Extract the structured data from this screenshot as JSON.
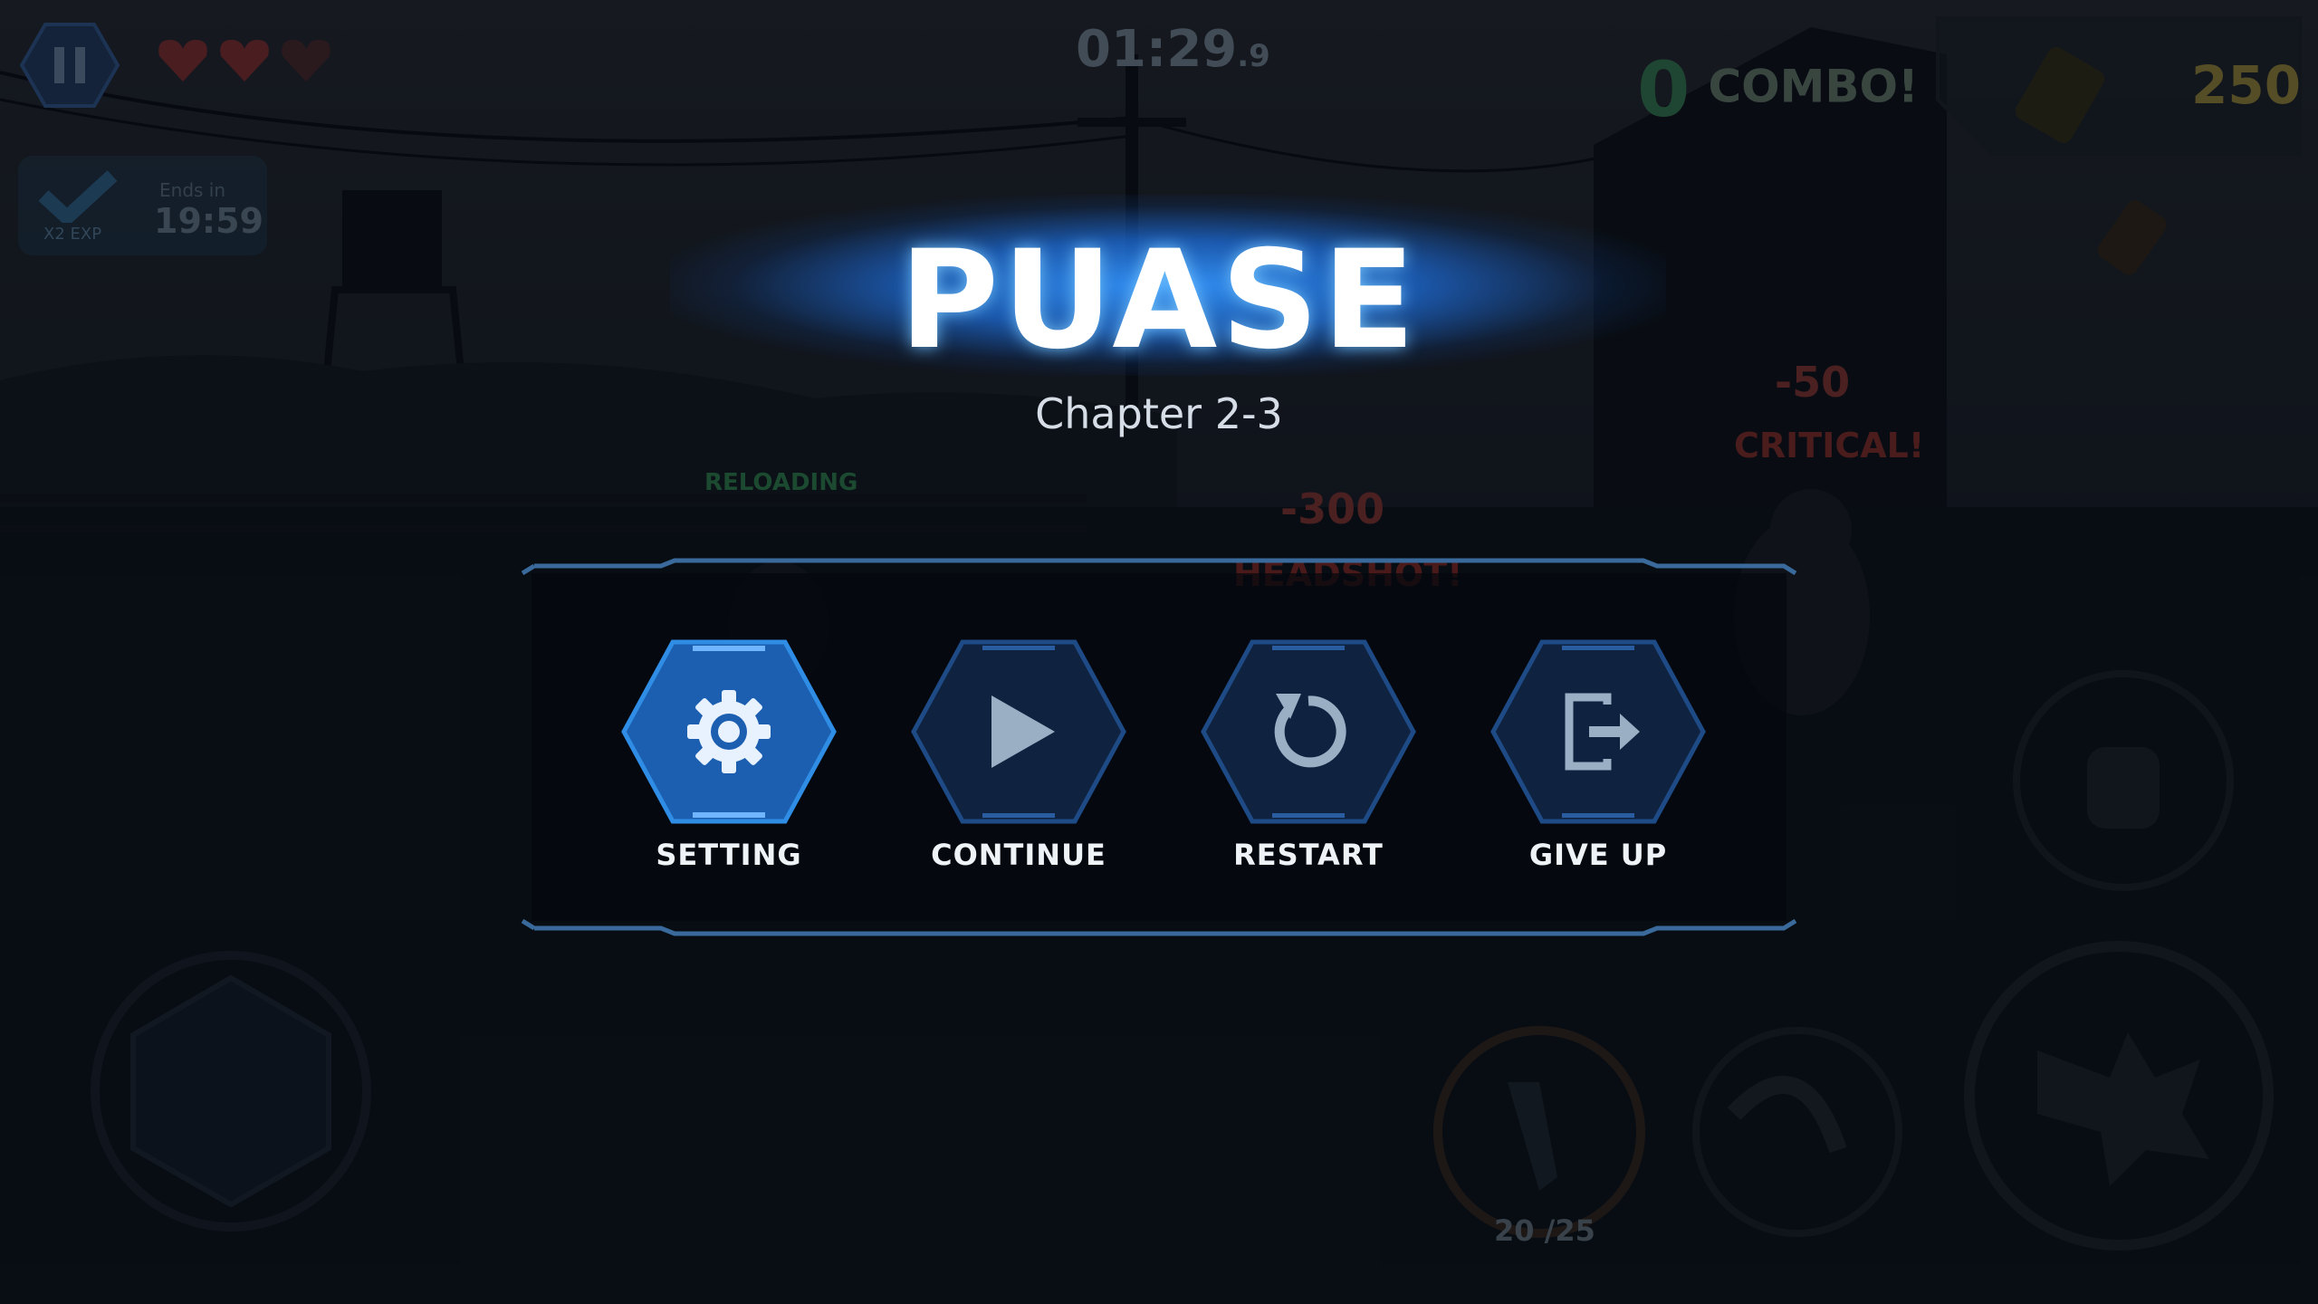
{
  "hud": {
    "timer_main": "01:29",
    "timer_fraction": ".9",
    "combo_count": "0",
    "combo_label": "COMBO!",
    "ammo_total": "250",
    "exp_label": "X2 EXP",
    "ends_label": "Ends in",
    "ends_time": "19:59",
    "reloading_label": "RELOADING",
    "damage_1": "-50",
    "damage_1_tag": "CRITICAL!",
    "damage_2": "-300",
    "damage_2_tag": "HEADSHOT!",
    "magazine_count": "20 /25",
    "hearts_full": 2,
    "hearts_total": 3
  },
  "pause": {
    "title": "PUASE",
    "chapter": "Chapter 2-3"
  },
  "menu": {
    "items": [
      {
        "label": "SETTING",
        "icon": "gear-icon",
        "active": true
      },
      {
        "label": "CONTINUE",
        "icon": "play-icon",
        "active": false
      },
      {
        "label": "RESTART",
        "icon": "restart-icon",
        "active": false
      },
      {
        "label": "GIVE UP",
        "icon": "exit-icon",
        "active": false
      }
    ]
  },
  "colors": {
    "accent_blue": "#2f7fd6",
    "hex_dark": "#0f2340",
    "hex_active": "#1c5fb0",
    "icon_light": "#e8f2ff",
    "icon_dim": "#8fa3b8"
  }
}
